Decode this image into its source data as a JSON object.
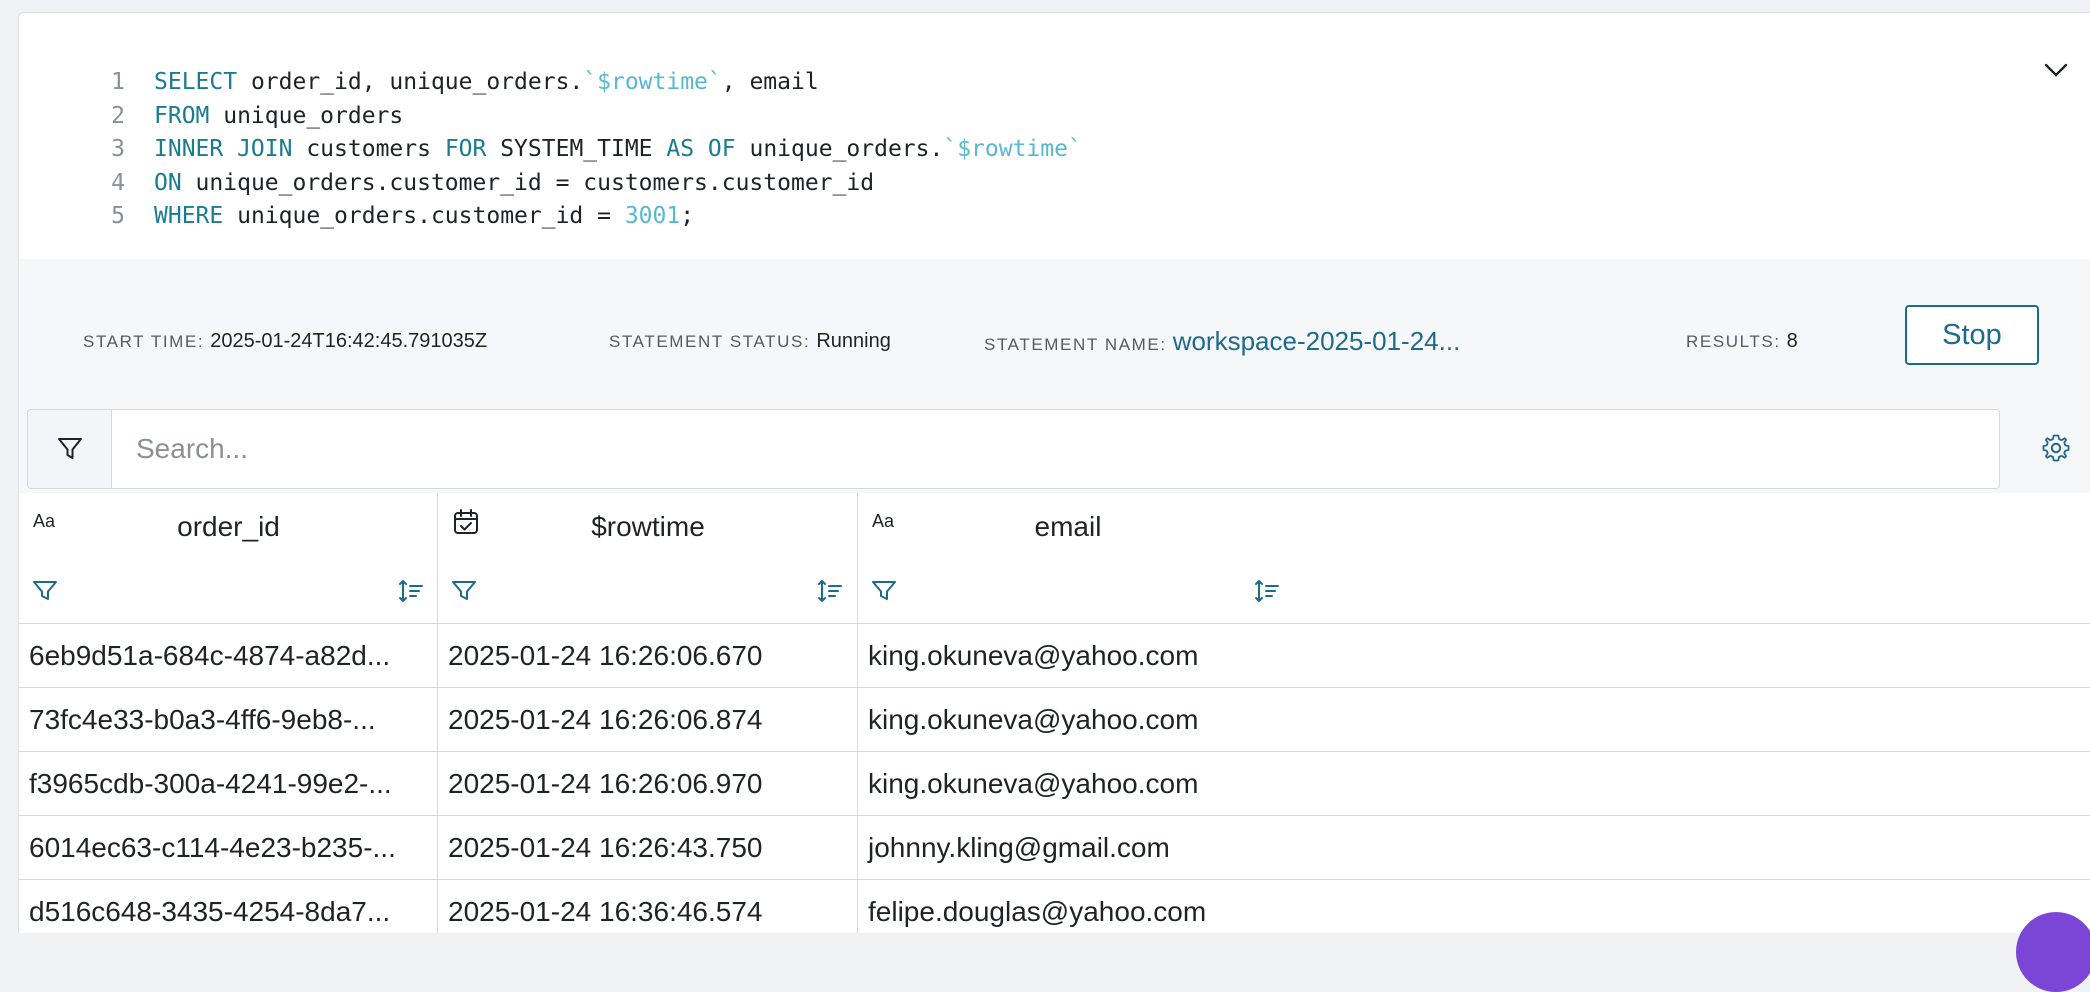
{
  "editor": {
    "lines": [
      {
        "no": "1",
        "parts": [
          {
            "t": "SELECT",
            "c": "kw"
          },
          {
            "t": " order_id, unique_orders.",
            "c": ""
          },
          {
            "t": "`$rowtime`",
            "c": "str"
          },
          {
            "t": ", email",
            "c": ""
          }
        ]
      },
      {
        "no": "2",
        "parts": [
          {
            "t": "FROM",
            "c": "kw"
          },
          {
            "t": " unique_orders",
            "c": ""
          }
        ]
      },
      {
        "no": "3",
        "parts": [
          {
            "t": "INNER JOIN",
            "c": "kw"
          },
          {
            "t": " customers ",
            "c": ""
          },
          {
            "t": "FOR",
            "c": "kw"
          },
          {
            "t": " SYSTEM_TIME ",
            "c": ""
          },
          {
            "t": "AS OF",
            "c": "kw"
          },
          {
            "t": " unique_orders.",
            "c": ""
          },
          {
            "t": "`$rowtime`",
            "c": "str"
          }
        ]
      },
      {
        "no": "4",
        "parts": [
          {
            "t": "ON",
            "c": "kw"
          },
          {
            "t": " unique_orders.customer_id = customers.customer_id",
            "c": ""
          }
        ]
      },
      {
        "no": "5",
        "parts": [
          {
            "t": "WHERE",
            "c": "kw"
          },
          {
            "t": " unique_orders.customer_id = ",
            "c": ""
          },
          {
            "t": "3001",
            "c": "num"
          },
          {
            "t": ";",
            "c": ""
          }
        ]
      }
    ],
    "collapse_icon": "chevron-down-icon"
  },
  "status": {
    "start_time_label": "START TIME:",
    "start_time": "2025-01-24T16:42:45.791035Z",
    "statement_status_label": "STATEMENT STATUS:",
    "statement_status": "Running",
    "statement_name_label": "STATEMENT NAME:",
    "statement_name": "workspace-2025-01-24...",
    "results_label": "RESULTS:",
    "results": "8",
    "stop_label": "Stop"
  },
  "search": {
    "placeholder": "Search...",
    "filter_icon": "filter-icon",
    "settings_icon": "gear-icon"
  },
  "table": {
    "columns": [
      {
        "name": "order_id",
        "type_icon": "Aa"
      },
      {
        "name": "$rowtime",
        "type_icon": "calendar-check-icon"
      },
      {
        "name": "email",
        "type_icon": "Aa"
      }
    ],
    "rows": [
      [
        "6eb9d51a-684c-4874-a82d...",
        "2025-01-24 16:26:06.670",
        "king.okuneva@yahoo.com"
      ],
      [
        "73fc4e33-b0a3-4ff6-9eb8-...",
        "2025-01-24 16:26:06.874",
        "king.okuneva@yahoo.com"
      ],
      [
        "f3965cdb-300a-4241-99e2-...",
        "2025-01-24 16:26:06.970",
        "king.okuneva@yahoo.com"
      ],
      [
        "6014ec63-c114-4e23-b235-...",
        "2025-01-24 16:26:43.750",
        "johnny.kling@gmail.com"
      ],
      [
        "d516c648-3435-4254-8da7...",
        "2025-01-24 16:36:46.574",
        "felipe.douglas@yahoo.com"
      ]
    ]
  },
  "colors": {
    "accent": "#1d6b8a",
    "keyword": "#1a7c8f",
    "literal": "#58b8d0"
  }
}
